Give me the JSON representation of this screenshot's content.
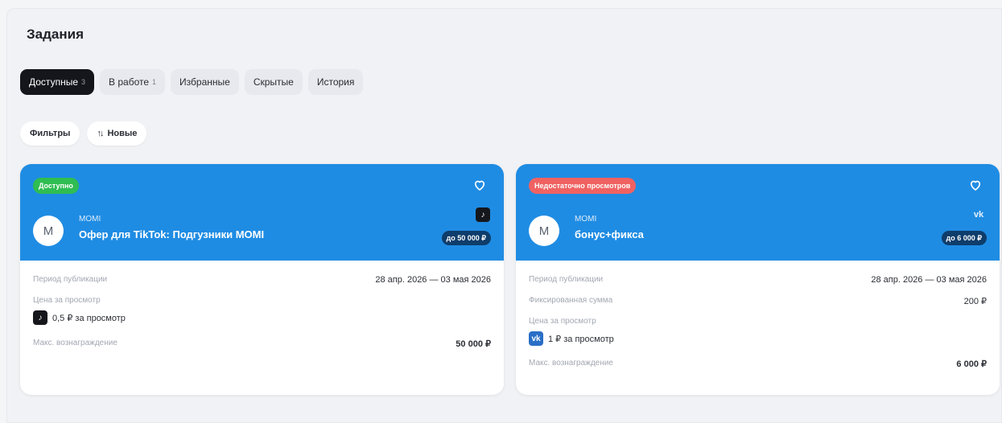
{
  "page": {
    "title": "Задания"
  },
  "tabs": [
    {
      "label": "Доступные",
      "count": "3"
    },
    {
      "label": "В работе",
      "count": "1"
    },
    {
      "label": "Избранные",
      "count": ""
    },
    {
      "label": "Скрытые",
      "count": ""
    },
    {
      "label": "История",
      "count": ""
    }
  ],
  "filters": {
    "filter_label": "Фильтры",
    "sort_label": "Новые",
    "sort_icon": "↑↓"
  },
  "colors": {
    "card_header": "#1f8ce3",
    "active_tab": "#14161c",
    "badge_available": "#2fbd52",
    "badge_warning": "#f06262"
  },
  "cards": [
    {
      "badge": "Доступно",
      "brand": "MOMI",
      "title": "Офер для TikTok: Подгузники MOMI",
      "avatar_letter": "M",
      "platform_icon": "tiktok-icon",
      "platform_glyph": "♪",
      "reward": "до 50 000 ₽",
      "period_label": "Период публикации",
      "period_value": "28 апр. 2026 — 03 мая 2026",
      "price_label": "Цена за просмотр",
      "price_value": "0,5 ₽ за просмотр",
      "max_label": "Макс. вознаграждение",
      "max_value": "50 000 ₽"
    },
    {
      "badge": "Недостаточно просмотров",
      "brand": "MOMI",
      "title": "бонус+фикса",
      "avatar_letter": "M",
      "platform_icon": "vk-icon",
      "platform_glyph": "vk",
      "reward": "до 6 000 ₽",
      "period_label": "Период публикации",
      "period_value": "28 апр. 2026 — 03 мая 2026",
      "fixed_label": "Фиксированная сумма",
      "fixed_value": "200 ₽",
      "price_label": "Цена за просмотр",
      "price_value": "1 ₽ за просмотр",
      "max_label": "Макс. вознаграждение",
      "max_value": "6 000 ₽"
    }
  ]
}
